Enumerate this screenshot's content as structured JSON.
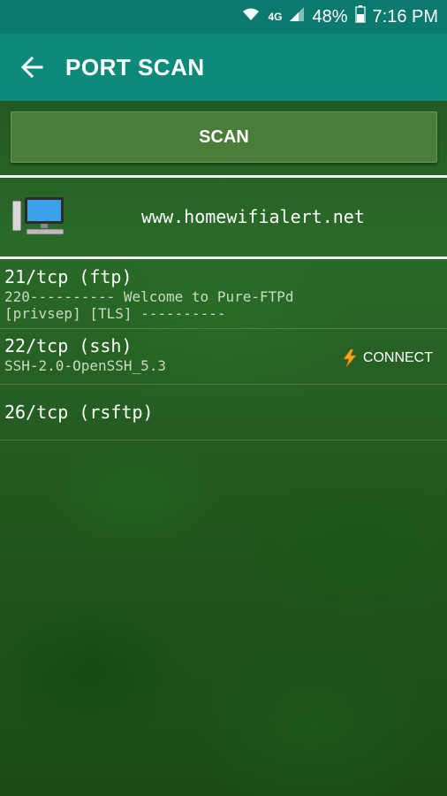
{
  "status": {
    "time": "7:16 PM",
    "battery": "48%",
    "network": "4G"
  },
  "appbar": {
    "title": "PORT SCAN"
  },
  "scan": {
    "label": "SCAN"
  },
  "host": {
    "name": "www.homewifialert.net"
  },
  "ports": [
    {
      "title": "21/tcp (ftp)",
      "banner": [
        "220---------- Welcome to Pure-FTPd",
        "[privsep] [TLS] ----------"
      ]
    },
    {
      "title": "22/tcp (ssh)",
      "banner": [
        "SSH-2.0-OpenSSH_5.3"
      ],
      "action": "CONNECT"
    },
    {
      "title": "26/tcp (rsftp)",
      "banner": []
    }
  ],
  "colors": {
    "statusbar": "#0b7a6e",
    "appbar": "#0e8a7b",
    "scan_button": "#4a7d3a",
    "accent_bolt": "#f5a623"
  }
}
